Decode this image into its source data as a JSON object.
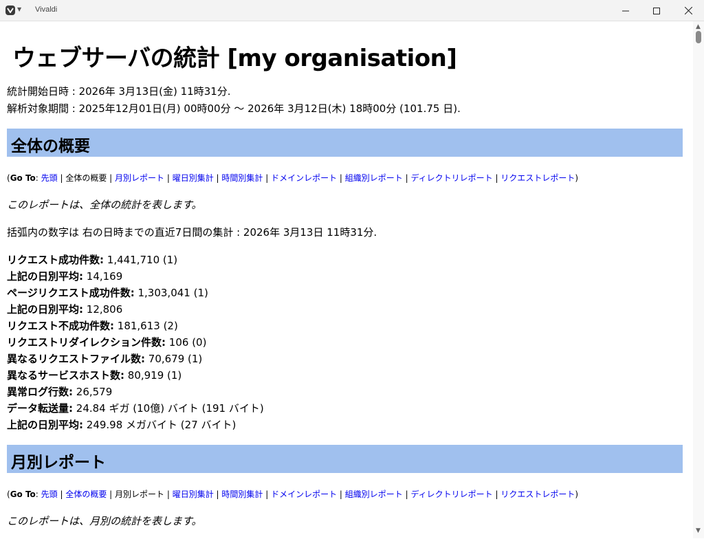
{
  "window": {
    "title": "Vivaldi",
    "controls": {
      "minimize": "minimize-icon",
      "maximize": "maximize-icon",
      "close": "close-icon"
    }
  },
  "page": {
    "title": "ウェブサーバの統計 [my organisation]",
    "generated": "統計開始日時 : 2026年 3月13日(金) 11時31分.",
    "period": "解析対象期間 : 2025年12月01日(月) 00時00分 〜 2026年 3月12日(木) 18時00分 (101.75 日)."
  },
  "goto": {
    "prefix": "Go To",
    "items": [
      "先頭",
      "全体の概要",
      "月別レポート",
      "曜日別集計",
      "時間別集計",
      "ドメインレポート",
      "組織別レポート",
      "ディレクトリレポート",
      "リクエストレポート"
    ]
  },
  "summary": {
    "heading": "全体の概要",
    "desc": "このレポートは、全体の統計を表します。",
    "note": "括弧内の数字は 右の日時までの直近7日間の集計 : 2026年 3月13日 11時31分.",
    "stats": [
      {
        "label": "リクエスト成功件数:",
        "value": "1,441,710 (1)"
      },
      {
        "label": "上記の日別平均:",
        "value": "14,169"
      },
      {
        "label": "ページリクエスト成功件数:",
        "value": "1,303,041 (1)"
      },
      {
        "label": "上記の日別平均:",
        "value": "12,806"
      },
      {
        "label": "リクエスト不成功件数:",
        "value": "181,613 (2)"
      },
      {
        "label": "リクエストリダイレクション件数:",
        "value": "106 (0)"
      },
      {
        "label": "異なるリクエストファイル数:",
        "value": "70,679 (1)"
      },
      {
        "label": "異なるサービスホスト数:",
        "value": "80,919 (1)"
      },
      {
        "label": "異常ログ行数:",
        "value": "26,579"
      },
      {
        "label": "データ転送量:",
        "value": "24.84 ギガ (10億) バイト (191 バイト)"
      },
      {
        "label": "上記の日別平均:",
        "value": "249.98 メガバイト (27 バイト)"
      }
    ]
  },
  "monthly": {
    "heading": "月別レポート",
    "desc": "このレポートは、月別の統計を表します。"
  }
}
